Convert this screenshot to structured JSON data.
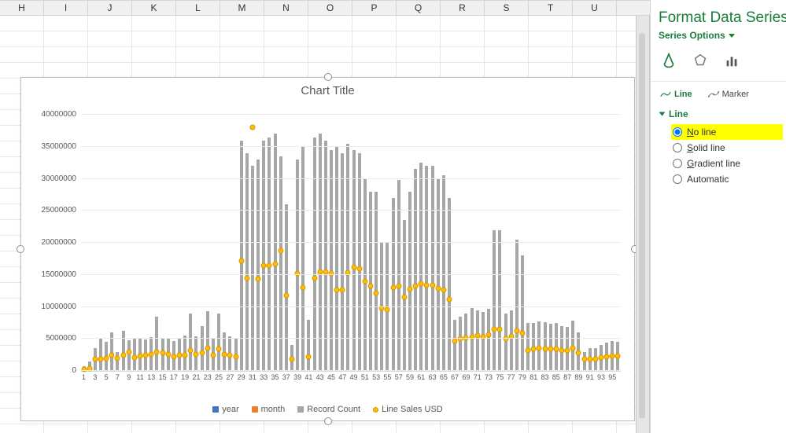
{
  "columns": [
    "H",
    "I",
    "J",
    "K",
    "L",
    "M",
    "N",
    "O",
    "P",
    "Q",
    "R",
    "S",
    "T",
    "U"
  ],
  "chart": {
    "title": "Chart Title",
    "ymax": 40000000,
    "yticks": [
      0,
      5000000,
      10000000,
      15000000,
      20000000,
      25000000,
      30000000,
      35000000,
      40000000
    ],
    "legend": [
      {
        "key": "year",
        "color": "blue"
      },
      {
        "key": "month",
        "color": "orange"
      },
      {
        "key": "Record Count",
        "color": "grey"
      },
      {
        "key": "Line Sales USD",
        "color": "gold"
      }
    ]
  },
  "chart_data": {
    "type": "bar",
    "title": "Chart Title",
    "xlabel": "",
    "ylabel": "",
    "ylim": [
      0,
      40000000
    ],
    "x": [
      1,
      2,
      3,
      4,
      5,
      6,
      7,
      8,
      9,
      10,
      11,
      12,
      13,
      14,
      15,
      16,
      17,
      18,
      19,
      20,
      21,
      22,
      23,
      24,
      25,
      26,
      27,
      28,
      29,
      30,
      31,
      32,
      33,
      34,
      35,
      36,
      37,
      38,
      39,
      40,
      41,
      42,
      43,
      44,
      45,
      46,
      47,
      48,
      49,
      50,
      51,
      52,
      53,
      54,
      55,
      56,
      57,
      58,
      59,
      60,
      61,
      62,
      63,
      64,
      65,
      66,
      67,
      68,
      69,
      70,
      71,
      72,
      73,
      74,
      75,
      76,
      77,
      78,
      79,
      80,
      81,
      82,
      83,
      84,
      85,
      86,
      87,
      88,
      89,
      90,
      91,
      92,
      93,
      94,
      95,
      96
    ],
    "series": [
      {
        "name": "Record Count",
        "type": "bar",
        "color": "#a6a6a6",
        "values": [
          700000,
          1500000,
          3500000,
          5000000,
          4500000,
          6000000,
          3000000,
          6200000,
          4800000,
          5200000,
          5000000,
          4900000,
          5300000,
          8500000,
          5000000,
          5100000,
          4700000,
          5000000,
          5500000,
          9000000,
          5400000,
          7000000,
          9300000,
          5000000,
          9000000,
          6000000,
          5400000,
          5100000,
          36000000,
          34000000,
          32000000,
          33000000,
          36000000,
          36500000,
          37000000,
          33500000,
          26000000,
          4000000,
          33000000,
          35000000,
          8000000,
          36500000,
          37000000,
          36000000,
          34500000,
          35000000,
          34000000,
          35500000,
          34500000,
          34000000,
          30000000,
          28000000,
          28000000,
          20000000,
          20000000,
          27000000,
          29800000,
          23500000,
          28000000,
          31500000,
          32500000,
          32000000,
          32000000,
          30000000,
          30500000,
          27000000,
          8000000,
          8500000,
          9000000,
          9800000,
          9500000,
          9200000,
          9700000,
          22000000,
          22000000,
          9000000,
          9500000,
          20500000,
          18000000,
          7500000,
          7500000,
          7700000,
          7600000,
          7400000,
          7500000,
          7000000,
          6900000,
          7800000,
          6000000,
          3000000,
          3500000,
          3600000,
          4100000,
          4400000,
          4700000,
          4500000
        ]
      },
      {
        "name": "Line Sales USD",
        "type": "scatter",
        "color": "#ffbf00",
        "values": [
          300000,
          400000,
          1800000,
          1800000,
          2000000,
          2500000,
          2000000,
          2400000,
          3000000,
          2100000,
          2300000,
          2500000,
          2600000,
          3000000,
          2800000,
          2600000,
          2200000,
          2400000,
          2500000,
          3200000,
          2600000,
          2800000,
          3500000,
          2500000,
          3400000,
          2600000,
          2400000,
          2200000,
          17200000,
          14500000,
          38000000,
          14400000,
          16400000,
          16400000,
          16700000,
          18800000,
          11800000,
          1800000,
          15200000,
          13000000,
          2200000,
          14500000,
          15500000,
          15500000,
          15200000,
          12700000,
          12700000,
          15400000,
          16200000,
          16000000,
          14000000,
          13200000,
          12200000,
          9800000,
          9600000,
          13000000,
          13200000,
          11500000,
          12800000,
          13300000,
          13600000,
          13400000,
          13400000,
          12900000,
          12600000,
          11200000,
          4700000,
          5000000,
          5200000,
          5300000,
          5500000,
          5300000,
          5600000,
          6500000,
          6500000,
          5000000,
          5400000,
          6300000,
          5900000,
          3200000,
          3400000,
          3600000,
          3400000,
          3400000,
          3400000,
          3200000,
          3200000,
          3600000,
          2800000,
          1900000,
          1800000,
          1900000,
          2100000,
          2200000,
          2300000,
          2300000
        ]
      }
    ]
  },
  "pane": {
    "title": "Format Data Series",
    "subtitle": "Series Options",
    "tabs": {
      "line": "Line",
      "marker": "Marker"
    },
    "section": "Line",
    "options": {
      "noline": "No line",
      "solid": "Solid line",
      "gradient": "Gradient line",
      "auto": "Automatic"
    }
  }
}
